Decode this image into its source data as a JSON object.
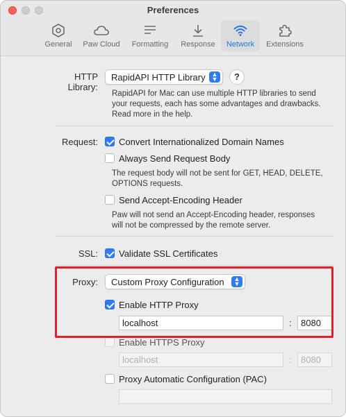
{
  "window": {
    "title": "Preferences"
  },
  "toolbar": {
    "tabs": [
      {
        "label": "General",
        "icon": "hexagon-icon"
      },
      {
        "label": "Paw Cloud",
        "icon": "cloud-icon"
      },
      {
        "label": "Formatting",
        "icon": "text-lines-icon"
      },
      {
        "label": "Response",
        "icon": "download-icon"
      },
      {
        "label": "Network",
        "icon": "wifi-icon",
        "active": true
      },
      {
        "label": "Extensions",
        "icon": "puzzle-icon"
      }
    ],
    "accent": "#1f7ae0"
  },
  "http_library": {
    "label": "HTTP Library:",
    "value": "RapidAPI HTTP Library",
    "help": "?",
    "description": [
      "RapidAPI for Mac can use multiple HTTP libraries to send",
      "your requests, each has some advantages and drawbacks.",
      "Read more in the help."
    ]
  },
  "request": {
    "label": "Request:",
    "convert_idn": {
      "label": "Convert Internationalized Domain Names",
      "checked": true
    },
    "always_send_body": {
      "label": "Always Send Request Body",
      "checked": false
    },
    "body_description": [
      "The request body will not be sent for GET, HEAD, DELETE,",
      "OPTIONS requests."
    ],
    "send_accept_encoding": {
      "label": "Send Accept-Encoding Header",
      "checked": false
    },
    "encoding_description": [
      "Paw will not send an Accept-Encoding header, responses",
      "will not be compressed by the remote server."
    ]
  },
  "ssl": {
    "label": "SSL:",
    "validate": {
      "label": "Validate SSL Certificates",
      "checked": true
    }
  },
  "proxy": {
    "label": "Proxy:",
    "mode": "Custom Proxy Configuration",
    "http": {
      "label": "Enable HTTP Proxy",
      "checked": true,
      "host": "localhost",
      "separator": ":",
      "port": "8080"
    },
    "https": {
      "label": "Enable HTTPS Proxy",
      "checked": false,
      "host": "localhost",
      "separator": ":",
      "port": "8080"
    },
    "pac": {
      "label": "Proxy Automatic Configuration (PAC)",
      "checked": false,
      "url": ""
    }
  },
  "highlight_color": "#e0202a"
}
